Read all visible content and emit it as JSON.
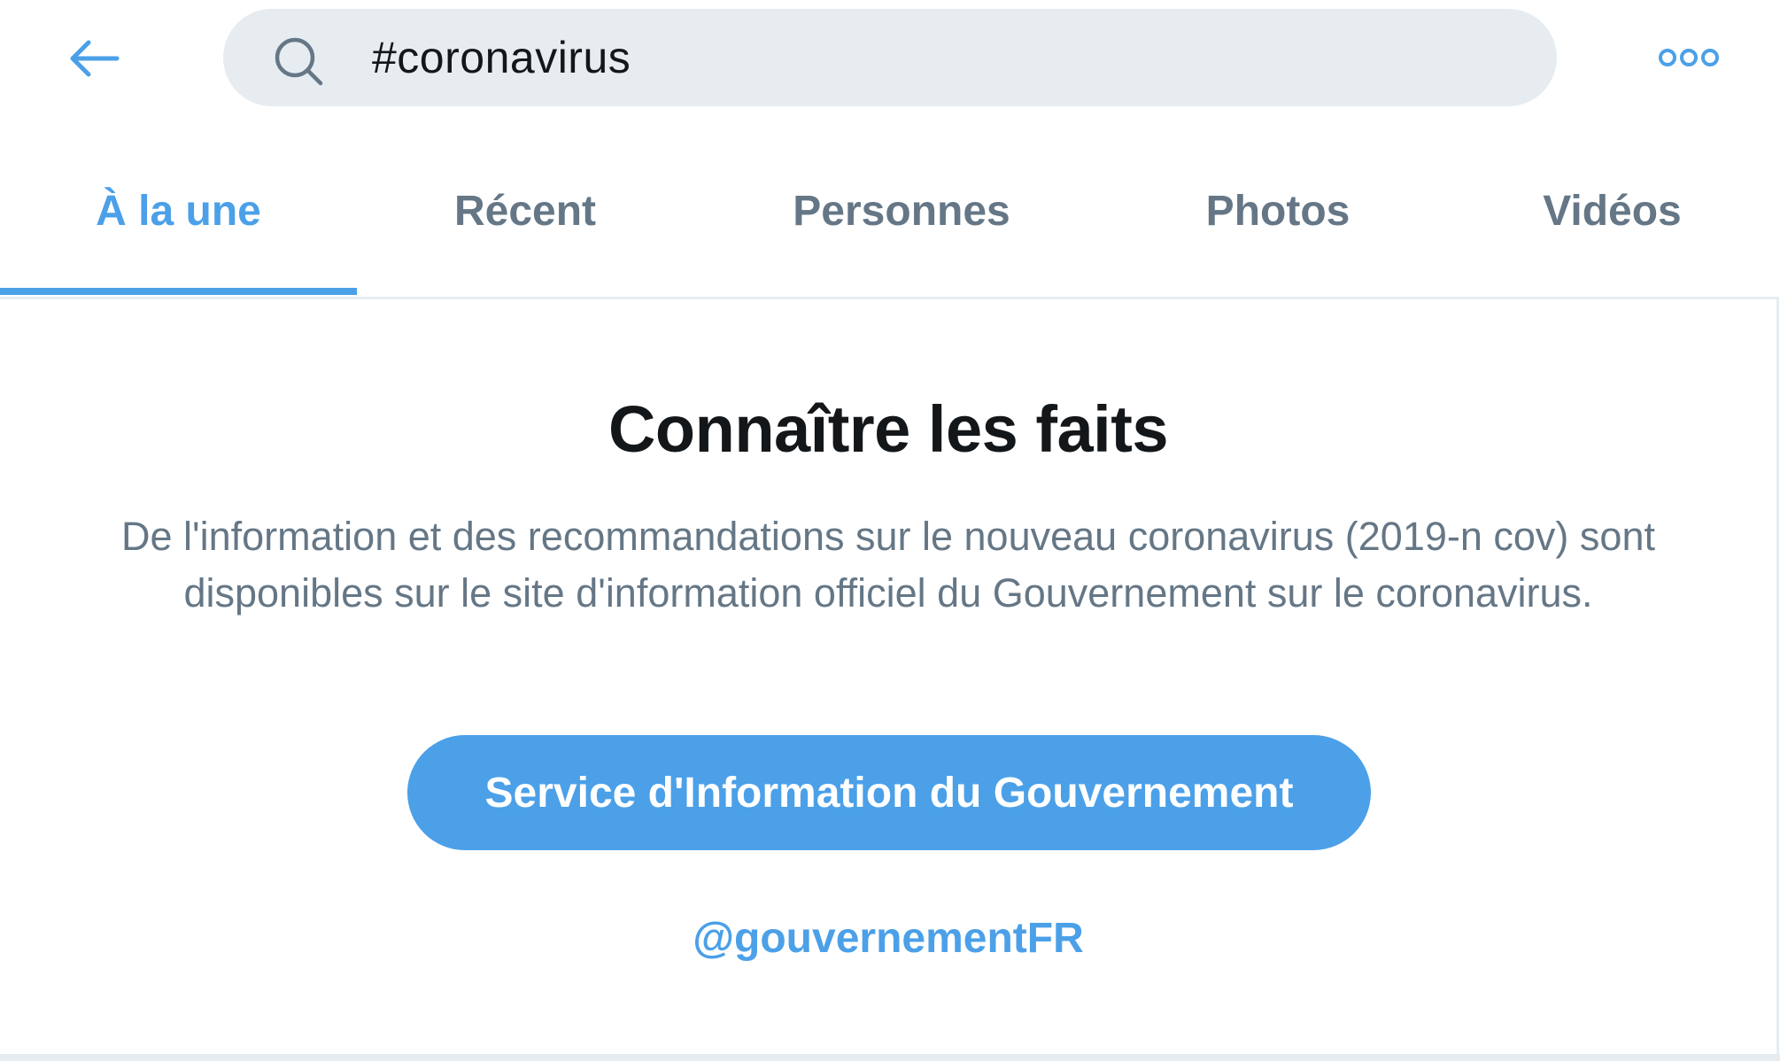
{
  "header": {
    "back_icon": "arrow-left-icon",
    "search": {
      "icon": "search-icon",
      "value": "#coronavirus"
    },
    "more_icon": "more-options-icon"
  },
  "tabs": [
    {
      "label": "À la une",
      "active": true
    },
    {
      "label": "Récent",
      "active": false
    },
    {
      "label": "Personnes",
      "active": false
    },
    {
      "label": "Photos",
      "active": false
    },
    {
      "label": "Vidéos",
      "active": false
    }
  ],
  "prompt": {
    "title": "Connaître les faits",
    "description": "De l'information et des recommandations sur le nouveau coronavirus (2019-n cov) sont disponibles sur le site d'information officiel du Gouvernement sur le coronavirus.",
    "button_label": "Service d'Information du Gouvernement",
    "handle": "@gouvernementFR"
  },
  "colors": {
    "accent": "#4ba0e8",
    "text_primary": "#14171a",
    "text_secondary": "#657786",
    "search_bg": "#e6ecf0"
  }
}
